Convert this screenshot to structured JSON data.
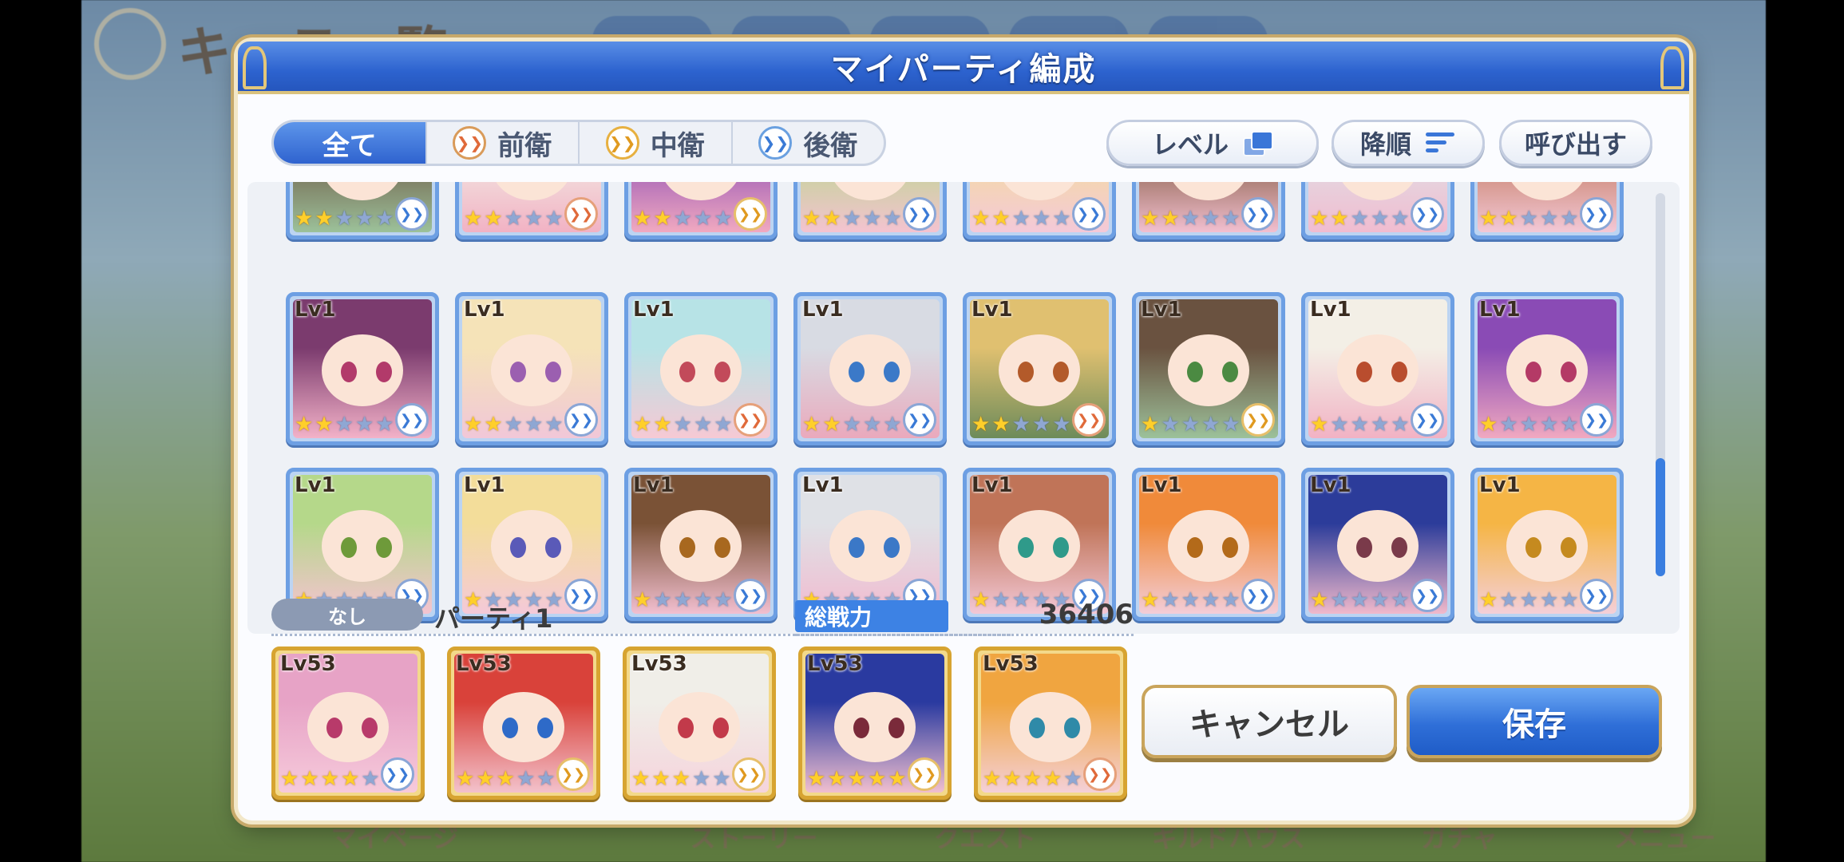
{
  "modal": {
    "title": "マイパーティ編成"
  },
  "filters": [
    {
      "label": "全て",
      "active": true,
      "icon": null
    },
    {
      "label": "前衛",
      "active": false,
      "icon": "front-role-icon"
    },
    {
      "label": "中衛",
      "active": false,
      "icon": "middle-role-icon"
    },
    {
      "label": "後衛",
      "active": false,
      "icon": "back-role-icon"
    }
  ],
  "sort": {
    "level_label": "レベル",
    "order_label": "降順",
    "recall_label": "呼び出す"
  },
  "grid": {
    "top_row": [
      {
        "stars": 2,
        "role": "back"
      },
      {
        "stars": 2,
        "role": "front"
      },
      {
        "stars": 2,
        "role": "middle"
      },
      {
        "stars": 2,
        "role": "back"
      },
      {
        "stars": 2,
        "role": "back"
      },
      {
        "stars": 2,
        "role": "back"
      },
      {
        "stars": 2,
        "role": "back"
      },
      {
        "stars": 2,
        "role": "back"
      }
    ],
    "rows": [
      [
        {
          "level": "Lv1",
          "stars": 2,
          "role": "back"
        },
        {
          "level": "Lv1",
          "stars": 2,
          "role": "back"
        },
        {
          "level": "Lv1",
          "stars": 2,
          "role": "front"
        },
        {
          "level": "Lv1",
          "stars": 2,
          "role": "back"
        },
        {
          "level": "Lv1",
          "stars": 2,
          "role": "front"
        },
        {
          "level": "Lv1",
          "stars": 1,
          "role": "middle"
        },
        {
          "level": "Lv1",
          "stars": 1,
          "role": "back"
        },
        {
          "level": "Lv1",
          "stars": 1,
          "role": "back"
        }
      ],
      [
        {
          "level": "Lv1",
          "stars": 1,
          "role": "back"
        },
        {
          "level": "Lv1",
          "stars": 1,
          "role": "back"
        },
        {
          "level": "Lv1",
          "stars": 1,
          "role": "back"
        },
        {
          "level": "Lv1",
          "stars": 1,
          "role": "back"
        },
        {
          "level": "Lv1",
          "stars": 1,
          "role": "back"
        },
        {
          "level": "Lv1",
          "stars": 1,
          "role": "back"
        },
        {
          "level": "Lv1",
          "stars": 1,
          "role": "back"
        },
        {
          "level": "Lv1",
          "stars": 1,
          "role": "back"
        }
      ]
    ]
  },
  "party": {
    "badge": "なし",
    "name": "パーティ1",
    "power_label": "総戦力",
    "power_value": "36406",
    "members": [
      {
        "level": "Lv53",
        "stars": 4,
        "role": "back"
      },
      {
        "level": "Lv53",
        "stars": 3,
        "role": "middle"
      },
      {
        "level": "Lv53",
        "stars": 3,
        "role": "middle"
      },
      {
        "level": "Lv53",
        "stars": 5,
        "role": "middle"
      },
      {
        "level": "Lv53",
        "stars": 4,
        "role": "front"
      }
    ]
  },
  "actions": {
    "cancel_label": "キャンセル",
    "save_label": "保存"
  },
  "background": {
    "title": "キャラ一覧",
    "nav": [
      "マイページ",
      "",
      "ストーリー",
      "クエスト",
      "ギルドハウス",
      "ガチャ",
      "メニュー"
    ]
  }
}
